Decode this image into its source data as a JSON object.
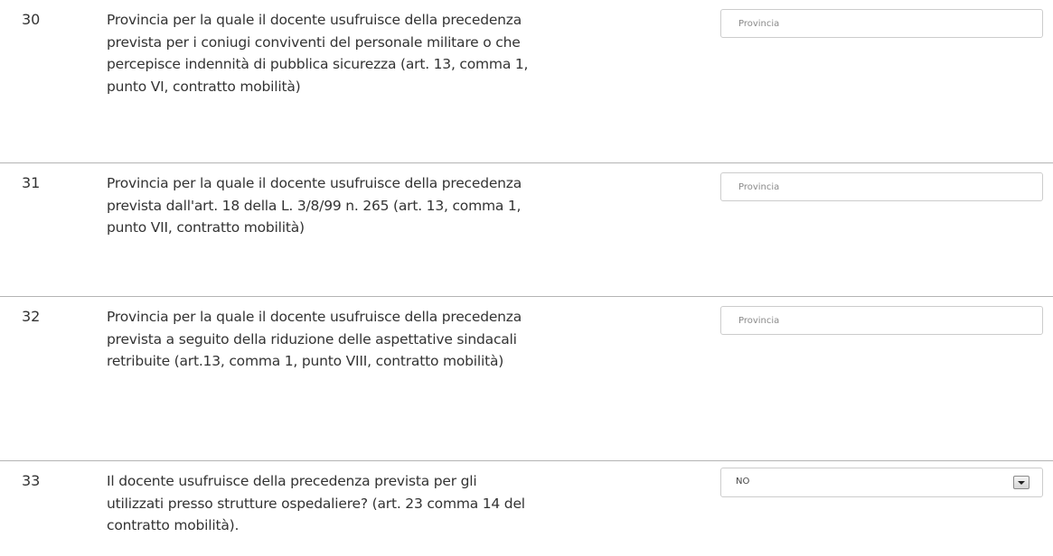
{
  "rows": [
    {
      "number": "30",
      "label": "Provincia per la quale il docente usufruisce della precedenza prevista per i coniugi conviventi del personale militare o che percepisce indennità di pubblica sicurezza (art. 13, comma 1, punto VI, contratto mobilità)",
      "placeholder": "Provincia"
    },
    {
      "number": "31",
      "label": "Provincia per la quale il docente usufruisce della precedenza prevista dall'art. 18 della L. 3/8/99 n. 265 (art. 13, comma 1, punto VII, contratto mobilità)",
      "placeholder": "Provincia"
    },
    {
      "number": "32",
      "label": "Provincia per la quale il docente usufruisce della precedenza prevista a seguito della riduzione delle aspettative sindacali retribuite (art.13, comma 1, punto VIII, contratto mobilità)",
      "placeholder": "Provincia"
    },
    {
      "number": "33",
      "label": "Il docente usufruisce della precedenza prevista per gli utilizzati presso strutture ospedaliere? (art. 23 comma 14 del contratto mobilità).",
      "selected": "NO",
      "icon": "dropdown-arrow-icon"
    }
  ]
}
